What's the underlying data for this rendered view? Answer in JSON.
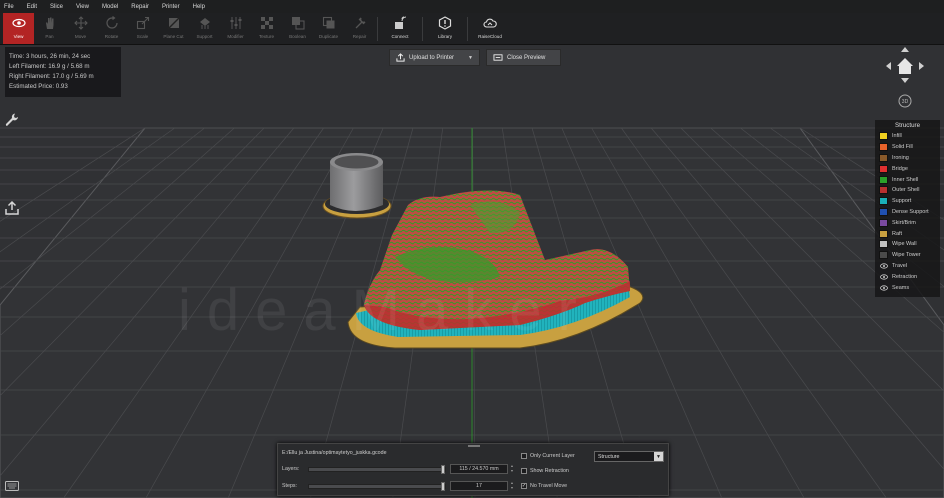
{
  "menu": [
    "File",
    "Edit",
    "Slice",
    "View",
    "Model",
    "Repair",
    "Printer",
    "Help"
  ],
  "toolbar": [
    {
      "label": "View",
      "icon": "eye-icon",
      "active": true
    },
    {
      "label": "Pan",
      "icon": "hand-icon"
    },
    {
      "label": "Move",
      "icon": "move-arrows-icon"
    },
    {
      "label": "Rotate",
      "icon": "rotate-icon"
    },
    {
      "label": "Scale",
      "icon": "scale-icon"
    },
    {
      "label": "Plane Cut",
      "icon": "plane-cut-icon"
    },
    {
      "label": "Support",
      "icon": "support-icon"
    },
    {
      "label": "Modifier",
      "icon": "modifier-icon"
    },
    {
      "label": "Texture",
      "icon": "texture-icon"
    },
    {
      "label": "Boolean",
      "icon": "boolean-icon"
    },
    {
      "label": "Duplicate",
      "icon": "duplicate-icon"
    },
    {
      "label": "Repair",
      "icon": "repair-icon"
    },
    {
      "label": "Connect",
      "icon": "connect-icon",
      "bright": true
    },
    {
      "label": "Library",
      "icon": "library-icon",
      "bright": true
    },
    {
      "label": "RaiseCloud",
      "icon": "cloud-icon",
      "bright": true
    }
  ],
  "info": {
    "time": "Time: 3 hours, 26 min, 24 sec",
    "left_filament": "Left Filament: 16.9 g / 5.68 m",
    "right_filament": "Right Filament: 17.0 g / 5.69 m",
    "price": "Estimated Price: 0.93"
  },
  "preview": {
    "upload_label": "Upload to Printer",
    "close_label": "Close Preview"
  },
  "watermark": "ideaMaker",
  "legend": {
    "title": "Structure",
    "items": [
      {
        "label": "Infill",
        "color": "#f0d020"
      },
      {
        "label": "Solid Fill",
        "color": "#e8622a"
      },
      {
        "label": "Ironing",
        "color": "#8a5a2a"
      },
      {
        "label": "Bridge",
        "color": "#e03030"
      },
      {
        "label": "Inner Shell",
        "color": "#2aa02a"
      },
      {
        "label": "Outer Shell",
        "color": "#b83030"
      },
      {
        "label": "Support",
        "color": "#1ab0b8"
      },
      {
        "label": "Dense Support",
        "color": "#2050b0"
      },
      {
        "label": "Skirt/Brim",
        "color": "#7a4aa0"
      },
      {
        "label": "Raft",
        "color": "#c8a040"
      },
      {
        "label": "Wipe Wall",
        "color": "#c0c0c0"
      },
      {
        "label": "Wipe Tower",
        "color": "#4a4a4a"
      }
    ],
    "toggles": [
      "Travel",
      "Retraction",
      "Seams"
    ]
  },
  "bottom": {
    "file": "E:/Ellu ja Justina/optimaytetyo_juskka.gcode",
    "layers_label": "Layers:",
    "layers_value": "115 / 24.570 mm",
    "layers_fraction": 0.97,
    "steps_label": "Steps:",
    "steps_value": "17",
    "steps_fraction": 0.97,
    "only_current_layer": "Only Current Layer",
    "show_retraction": "Show Retraction",
    "no_travel_move": "No Travel Move",
    "no_travel_checked": true,
    "structure_select": "Structure"
  }
}
